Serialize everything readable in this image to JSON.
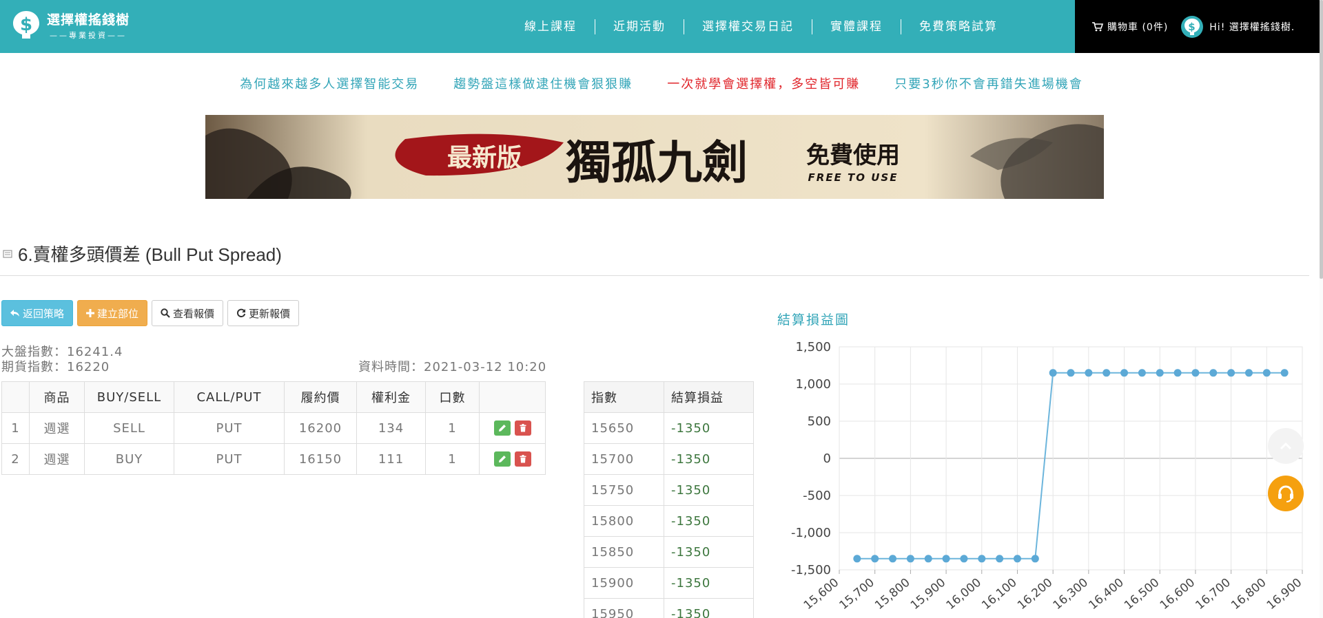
{
  "header": {
    "logo_title": "選擇權搖錢樹",
    "logo_subtitle": "專業投資",
    "nav": [
      "線上課程",
      "近期活動",
      "選擇權交易日記",
      "實體課程",
      "免費策略試算"
    ],
    "cart": "購物車 (0件)",
    "greeting": "Hi! 選擇權搖錢樹."
  },
  "promo_links": [
    {
      "text": "為何越來越多人選擇智能交易",
      "highlight": false
    },
    {
      "text": "趨勢盤這樣做逮住機會狠狠賺",
      "highlight": false
    },
    {
      "text": "一次就學會選擇權，多空皆可賺",
      "highlight": true
    },
    {
      "text": "只要3秒你不會再錯失進場機會",
      "highlight": false
    }
  ],
  "banner": {
    "tag": "最新版",
    "title": "獨孤九劍",
    "cta": "免費使用",
    "cta_en": "FREE TO USE"
  },
  "page_title": "6.賣權多頭價差 (Bull Put Spread)",
  "buttons": {
    "back": "返回策略",
    "create": "建立部位",
    "view_quote": "查看報價",
    "refresh_quote": "更新報價"
  },
  "market": {
    "index_label": "大盤指數：16241.4",
    "futures_label": "期貨指數：16220",
    "data_time": "資料時間：2021-03-12 10:20"
  },
  "positions_table": {
    "headers": [
      "",
      "商品",
      "BUY/SELL",
      "CALL/PUT",
      "履約價",
      "權利金",
      "口數",
      ""
    ],
    "rows": [
      [
        "1",
        "週選",
        "SELL",
        "PUT",
        "16200",
        "134",
        "1"
      ],
      [
        "2",
        "週選",
        "BUY",
        "PUT",
        "16150",
        "111",
        "1"
      ]
    ]
  },
  "pl_table": {
    "headers": [
      "指數",
      "結算損益"
    ],
    "rows": [
      [
        "15650",
        "-1350"
      ],
      [
        "15700",
        "-1350"
      ],
      [
        "15750",
        "-1350"
      ],
      [
        "15800",
        "-1350"
      ],
      [
        "15850",
        "-1350"
      ],
      [
        "15900",
        "-1350"
      ],
      [
        "15950",
        "-1350"
      ]
    ]
  },
  "chart_title": "結算損益圖",
  "chart_data": {
    "type": "line",
    "x": [
      15650,
      15700,
      15750,
      15800,
      15850,
      15900,
      15950,
      16000,
      16050,
      16100,
      16150,
      16200,
      16250,
      16300,
      16350,
      16400,
      16450,
      16500,
      16550,
      16600,
      16650,
      16700,
      16750,
      16800,
      16850
    ],
    "values": [
      -1350,
      -1350,
      -1350,
      -1350,
      -1350,
      -1350,
      -1350,
      -1350,
      -1350,
      -1350,
      -1350,
      1150,
      1150,
      1150,
      1150,
      1150,
      1150,
      1150,
      1150,
      1150,
      1150,
      1150,
      1150,
      1150,
      1150
    ],
    "xlim": [
      15600,
      16900
    ],
    "ylim": [
      -1500,
      1500
    ],
    "x_ticks": [
      "15,600",
      "15,700",
      "15,800",
      "15,900",
      "16,000",
      "16,100",
      "16,200",
      "16,300",
      "16,400",
      "16,500",
      "16,600",
      "16,700",
      "16,800",
      "16,900"
    ],
    "y_ticks": [
      "1,500",
      "1,000",
      "500",
      "0",
      "-500",
      "-1,000",
      "-1,500"
    ],
    "grid": true,
    "line_color": "#6cb5dc",
    "point_color": "#5ca9d6"
  },
  "colors": {
    "header_bg": "#33afb8",
    "account_bg": "#000000",
    "link": "#33a5b8",
    "link_highlight": "#e0242a",
    "profit_text": "#3c763d"
  },
  "icons": [
    "logo-money-tree-icon",
    "cart-icon",
    "reply-icon",
    "plus-icon",
    "search-icon",
    "refresh-icon",
    "pencil-icon",
    "trash-icon",
    "chevron-up-icon",
    "headset-icon"
  ]
}
